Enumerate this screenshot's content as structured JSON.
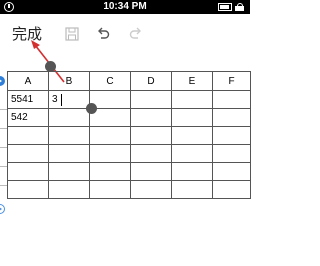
{
  "status_bar": {
    "time": "10:34 PM"
  },
  "toolbar": {
    "done_label": "完成",
    "save_icon": "save-icon",
    "undo_icon": "undo-icon",
    "redo_icon": "redo-icon"
  },
  "sheet": {
    "columns": [
      "A",
      "B",
      "C",
      "D",
      "E",
      "F"
    ],
    "rows": [
      [
        "5541",
        "3",
        "",
        "",
        "",
        ""
      ],
      [
        "542",
        "",
        "",
        "",
        "",
        ""
      ],
      [
        "",
        "",
        "",
        "",
        "",
        ""
      ],
      [
        "",
        "",
        "",
        "",
        "",
        ""
      ],
      [
        "",
        "",
        "",
        "",
        "",
        ""
      ],
      [
        "",
        "",
        "",
        "",
        "",
        ""
      ]
    ]
  },
  "colors": {
    "accent": "#2f7fd8",
    "arrow": "#d32f2f"
  }
}
